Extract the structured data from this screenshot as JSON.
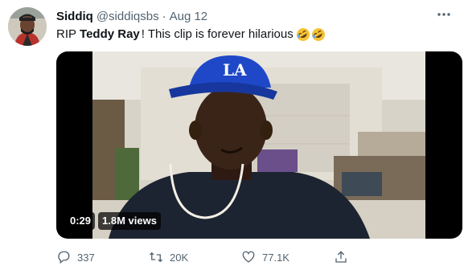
{
  "tweet": {
    "author_name": "Siddiq",
    "handle": "@siddiqsbs",
    "separator": "·",
    "date": "Aug 12",
    "text_before": "RIP",
    "text_bold": "Teddy Ray",
    "text_after": "! This clip is forever hilarious",
    "emoji": "rolling-on-floor-laughing-icon"
  },
  "media": {
    "duration": "0:29",
    "views": "1.8M views"
  },
  "actions": {
    "reply_count": "337",
    "retweet_count": "20K",
    "like_count": "77.1K"
  },
  "colors": {
    "text_primary": "#0f1419",
    "text_secondary": "#536471",
    "hat_blue": "#1e48c8"
  }
}
